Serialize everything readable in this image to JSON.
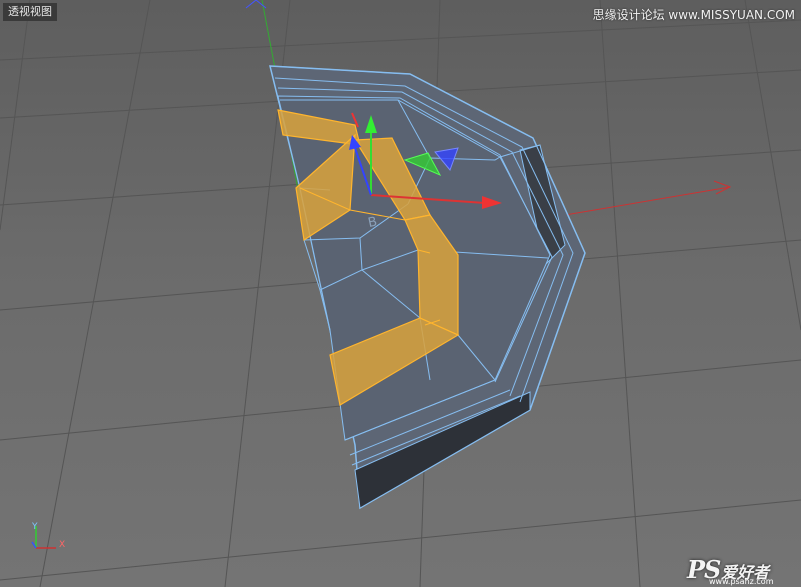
{
  "viewport": {
    "label": "透视视图",
    "watermark_top": "思缘设计论坛 www.MISSYUAN.COM",
    "watermark_bottom_logo": "PS",
    "watermark_bottom_cn": "爱好者",
    "watermark_bottom_url": "www.psahz.com"
  },
  "axis_gizmo": {
    "y_label": "Y",
    "x_label": "X"
  },
  "object_label": "B",
  "colors": {
    "selection_fill": "#d9a23c",
    "selection_edge": "#ffb52e",
    "mesh_fill": "#5d6675",
    "mesh_edge": "#86bdf0",
    "axis_x": "#ff3333",
    "axis_y": "#33dd33",
    "axis_z": "#3344ff"
  }
}
